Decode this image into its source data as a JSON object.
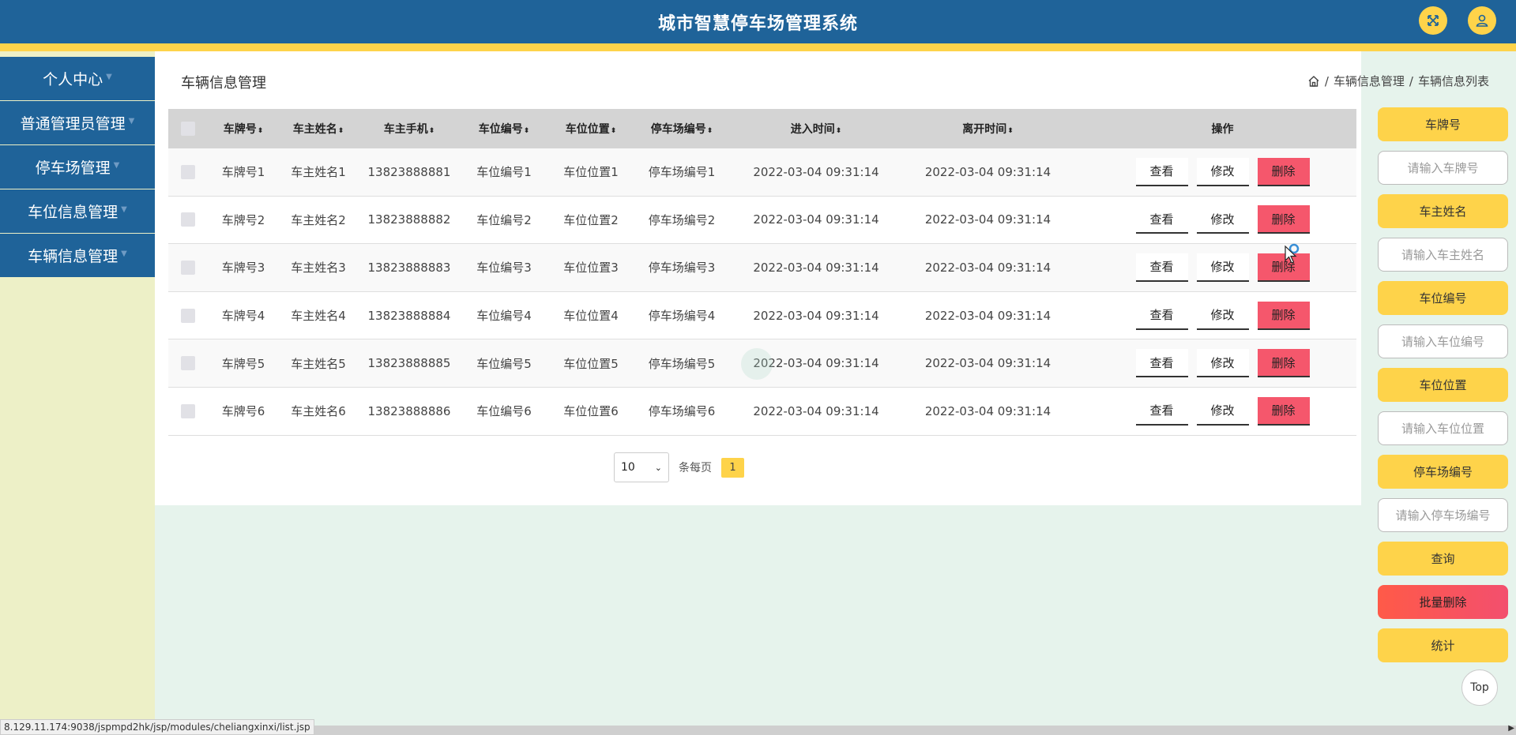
{
  "header": {
    "title": "城市智慧停车场管理系统"
  },
  "sidebar": {
    "items": [
      {
        "label": "个人中心"
      },
      {
        "label": "普通管理员管理"
      },
      {
        "label": "停车场管理"
      },
      {
        "label": "车位信息管理"
      },
      {
        "label": "车辆信息管理"
      }
    ]
  },
  "page": {
    "title": "车辆信息管理",
    "breadcrumb": [
      "车辆信息管理",
      "车辆信息列表"
    ]
  },
  "table": {
    "headers": [
      "车牌号",
      "车主姓名",
      "车主手机",
      "车位编号",
      "车位位置",
      "停车场编号",
      "进入时间",
      "离开时间",
      "操作"
    ],
    "rows": [
      [
        "车牌号1",
        "车主姓名1",
        "13823888881",
        "车位编号1",
        "车位位置1",
        "停车场编号1",
        "2022-03-04 09:31:14",
        "2022-03-04 09:31:14"
      ],
      [
        "车牌号2",
        "车主姓名2",
        "13823888882",
        "车位编号2",
        "车位位置2",
        "停车场编号2",
        "2022-03-04 09:31:14",
        "2022-03-04 09:31:14"
      ],
      [
        "车牌号3",
        "车主姓名3",
        "13823888883",
        "车位编号3",
        "车位位置3",
        "停车场编号3",
        "2022-03-04 09:31:14",
        "2022-03-04 09:31:14"
      ],
      [
        "车牌号4",
        "车主姓名4",
        "13823888884",
        "车位编号4",
        "车位位置4",
        "停车场编号4",
        "2022-03-04 09:31:14",
        "2022-03-04 09:31:14"
      ],
      [
        "车牌号5",
        "车主姓名5",
        "13823888885",
        "车位编号5",
        "车位位置5",
        "停车场编号5",
        "2022-03-04 09:31:14",
        "2022-03-04 09:31:14"
      ],
      [
        "车牌号6",
        "车主姓名6",
        "13823888886",
        "车位编号6",
        "车位位置6",
        "停车场编号6",
        "2022-03-04 09:31:14",
        "2022-03-04 09:31:14"
      ]
    ],
    "actions": {
      "view": "查看",
      "edit": "修改",
      "delete": "删除"
    }
  },
  "pagination": {
    "page_size": "10",
    "per_page_label": "条每页",
    "current_page": "1"
  },
  "search": {
    "fields": [
      {
        "label": "车牌号",
        "placeholder": "请输入车牌号"
      },
      {
        "label": "车主姓名",
        "placeholder": "请输入车主姓名"
      },
      {
        "label": "车位编号",
        "placeholder": "请输入车位编号"
      },
      {
        "label": "车位位置",
        "placeholder": "请输入车位位置"
      },
      {
        "label": "停车场编号",
        "placeholder": "请输入停车场编号"
      }
    ],
    "query_label": "查询",
    "batch_delete_label": "批量删除",
    "stats_label": "统计"
  },
  "top_button": "Top",
  "status_url": "8.129.11.174:9038/jspmpd2hk/jsp/modules/cheliangxinxi/list.jsp",
  "colors": {
    "header": "#1f6399",
    "accent": "#fed34a",
    "danger": "#f5576c",
    "sidebar_bg": "#edf0c7",
    "content_bg": "#e6f3ec"
  }
}
